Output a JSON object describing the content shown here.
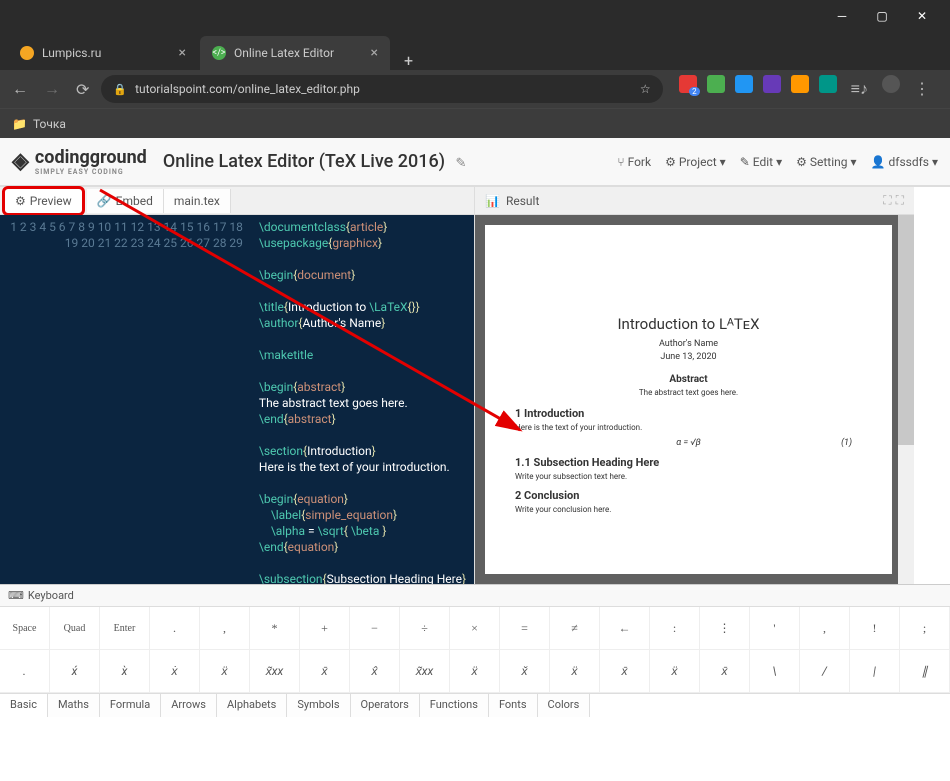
{
  "browser": {
    "tabs": [
      {
        "title": "Lumpics.ru"
      },
      {
        "title": "Online Latex Editor"
      }
    ],
    "url": "tutorialspoint.com/online_latex_editor.php",
    "bookmark": "Точка"
  },
  "header": {
    "logo": "codingground",
    "logo_sub": "SIMPLY EASY CODING",
    "title": "Online Latex Editor (TeX Live 2016)",
    "actions": {
      "fork": "Fork",
      "project": "Project",
      "edit": "Edit",
      "setting": "Setting",
      "user": "dfssdfs"
    }
  },
  "editor": {
    "tabs": {
      "preview": "Preview",
      "embed": "Embed",
      "file": "main.tex"
    },
    "lines": [
      1,
      2,
      3,
      4,
      5,
      6,
      7,
      8,
      9,
      10,
      11,
      12,
      13,
      14,
      15,
      16,
      17,
      18,
      19,
      20,
      21,
      22,
      23,
      24,
      25,
      26,
      27,
      28,
      29
    ]
  },
  "result": {
    "label": "Result"
  },
  "doc": {
    "title": "Introduction to LᴬTᴇX",
    "author": "Author's Name",
    "date": "June 13, 2020",
    "abs_h": "Abstract",
    "abs": "The abstract text goes here.",
    "sec1": "1   Introduction",
    "txt1": "Here is the text of your introduction.",
    "eq": "α = √β",
    "eqn": "(1)",
    "sub": "1.1   Subsection Heading Here",
    "subt": "Write your subsection text here.",
    "sec2": "2   Conclusion",
    "txt2": "Write your conclusion here."
  },
  "keyboard": {
    "label": "Keyboard",
    "row1": [
      "Space",
      "Quad",
      "Enter",
      ".",
      ",",
      "*",
      "+",
      "−",
      "÷",
      "×",
      "=",
      "≠",
      "←",
      ":",
      "⋮",
      "'",
      ",",
      "!",
      ";"
    ],
    "row2": [
      ".",
      "x́",
      "x̀",
      "ẋ",
      "ẍ",
      "x͂xx",
      "x̄",
      "x̂",
      "x͂xx",
      "ẍ",
      "x̌",
      "ẍ",
      "x̄",
      "ẍ",
      "x̄",
      "\\",
      "/",
      "|",
      "∥"
    ],
    "cats": [
      "Basic",
      "Maths",
      "Formula",
      "Arrows",
      "Alphabets",
      "Symbols",
      "Operators",
      "Functions",
      "Fonts",
      "Colors"
    ]
  }
}
